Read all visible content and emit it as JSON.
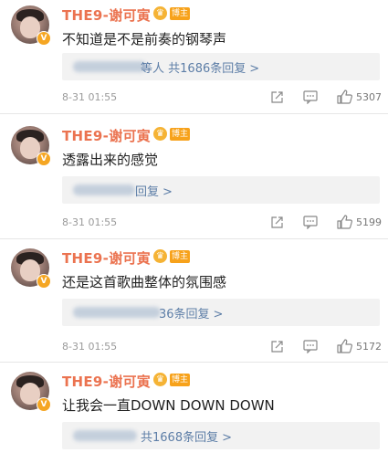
{
  "comments": [
    {
      "username": "THE9-谢可寅",
      "badge_label": "博主",
      "text": "不知道是不是前奏的钢琴声",
      "reply_suffix": "等人",
      "reply_count_label": "共1686条回复",
      "reply_chevron": ">",
      "date": "8-31 01:55",
      "likes": "5307"
    },
    {
      "username": "THE9-谢可寅",
      "badge_label": "博主",
      "text": "透露出来的感觉",
      "reply_suffix": "",
      "reply_count_label": "回复",
      "reply_chevron": ">",
      "date": "8-31 01:55",
      "likes": "5199"
    },
    {
      "username": "THE9-谢可寅",
      "badge_label": "博主",
      "text": "还是这首歌曲整体的氛围感",
      "reply_suffix": "",
      "reply_count_label": "36条回复",
      "reply_chevron": ">",
      "date": "8-31 01:55",
      "likes": "5172"
    },
    {
      "username": "THE9-谢可寅",
      "badge_label": "博主",
      "text": "让我会一直DOWN DOWN DOWN",
      "reply_suffix": "",
      "reply_count_label": "共1668条回复",
      "reply_chevron": ">",
      "date": "",
      "likes": ""
    }
  ],
  "icons": {
    "verified": "verified-badge-icon",
    "crown": "crown-icon",
    "share": "share-icon",
    "comment": "comment-icon",
    "like": "thumbs-up-icon"
  },
  "colors": {
    "username": "#eb7350",
    "reply_link": "#5d7ea7",
    "tag_bg": "#f7a21b"
  }
}
